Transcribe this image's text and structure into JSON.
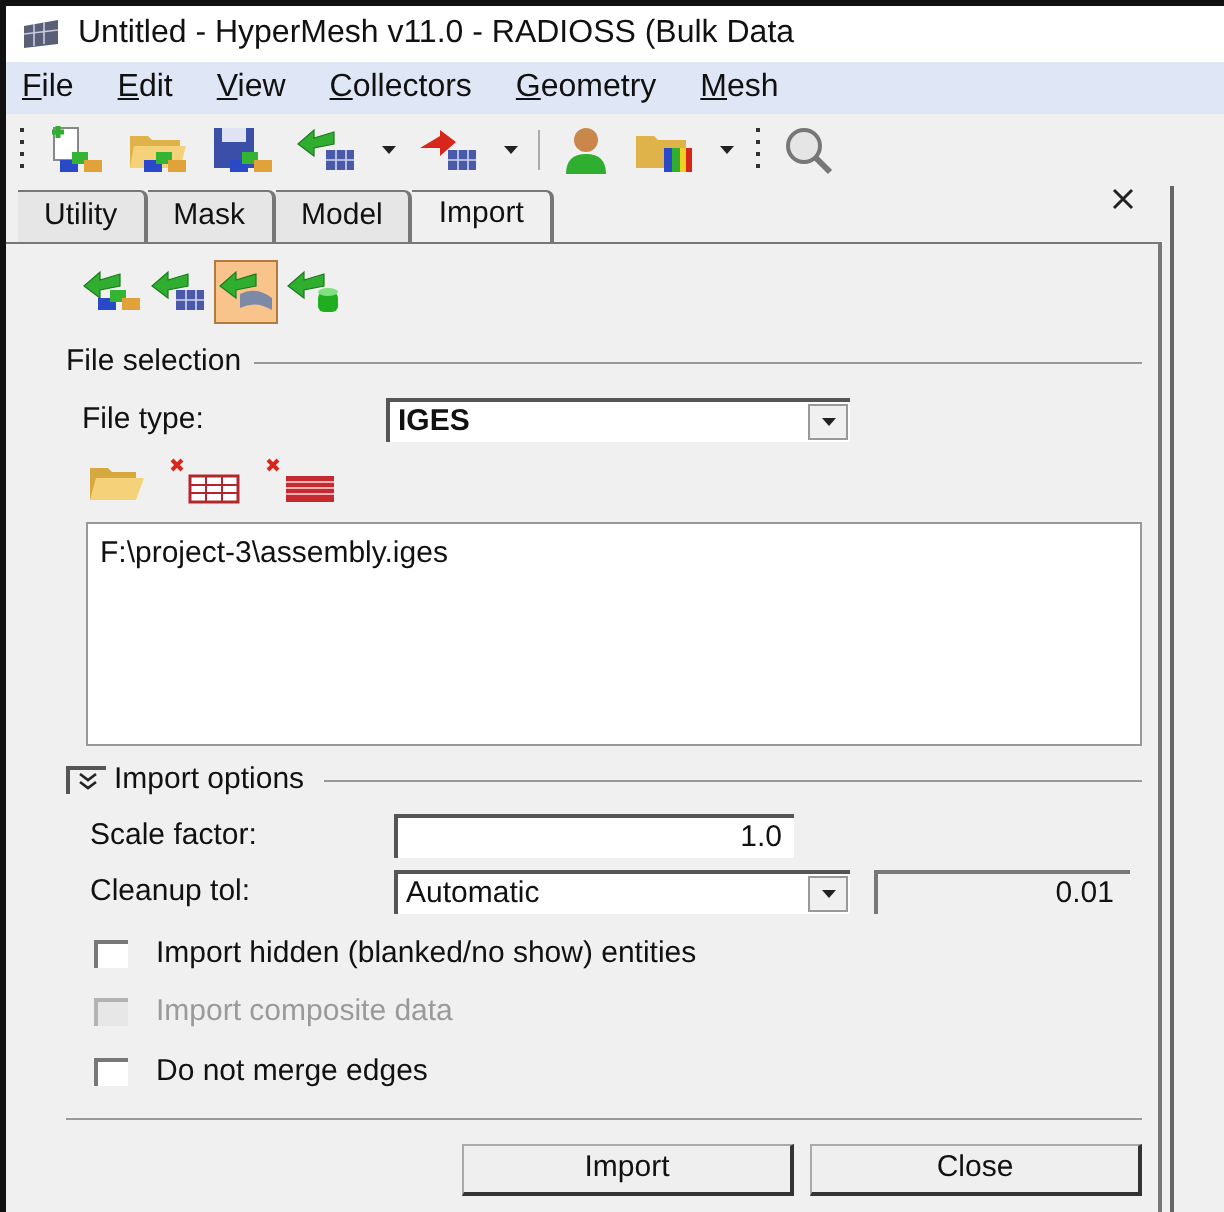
{
  "window": {
    "title": "Untitled - HyperMesh v11.0 - RADIOSS (Bulk Data"
  },
  "menu": [
    "File",
    "Edit",
    "View",
    "Collectors",
    "Geometry",
    "Mesh"
  ],
  "tabs": [
    {
      "label": "Utility",
      "selected": false
    },
    {
      "label": "Mask",
      "selected": false
    },
    {
      "label": "Model",
      "selected": false
    },
    {
      "label": "Import",
      "selected": true
    }
  ],
  "import_types": [
    {
      "kind": "solids",
      "selected": false
    },
    {
      "kind": "mesh",
      "selected": false
    },
    {
      "kind": "geometry",
      "selected": true
    },
    {
      "kind": "connectors",
      "selected": false
    }
  ],
  "file_selection": {
    "title": "File selection",
    "file_type_label": "File type:",
    "file_type": "IGES",
    "files": [
      "F:\\project-3\\assembly.iges"
    ]
  },
  "import_options": {
    "title": "Import options",
    "expanded": true,
    "scale_label": "Scale factor:",
    "scale": "1.0",
    "cleanup_label": "Cleanup tol:",
    "cleanup": "Automatic",
    "cleanup_value": "0.01",
    "checks": [
      {
        "label": "Import hidden (blanked/no show) entities",
        "checked": false,
        "disabled": false
      },
      {
        "label": "Import composite data",
        "checked": false,
        "disabled": true
      },
      {
        "label": "Do not merge edges",
        "checked": false,
        "disabled": false
      }
    ]
  },
  "buttons": [
    "Import",
    "Close"
  ]
}
